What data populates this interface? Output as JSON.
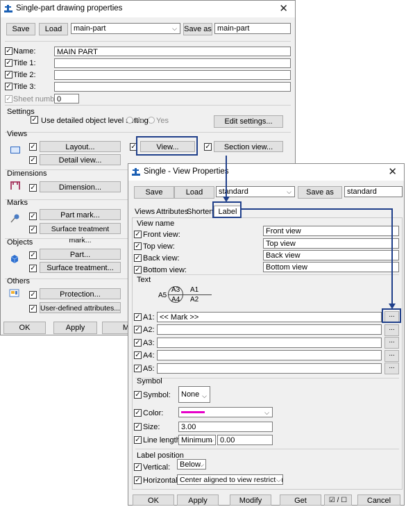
{
  "win1": {
    "title": "Single-part drawing properties",
    "close": "✕",
    "toolbar": {
      "save": "Save",
      "load": "Load",
      "preset": "main-part",
      "save_as": "Save as",
      "save_as_name": "main-part"
    },
    "fields": {
      "name_label": "Name:",
      "name_value": "MAIN PART",
      "title1_label": "Title 1:",
      "title2_label": "Title 2:",
      "title3_label": "Title 3:",
      "sheet_label": "Sheet number",
      "sheet_value": "0"
    },
    "settings": {
      "heading": "Settings",
      "detailed_label": "Use detailed object level settings",
      "no": "No",
      "yes": "Yes",
      "edit": "Edit settings..."
    },
    "views": {
      "heading": "Views",
      "layout": "Layout...",
      "view": "View...",
      "section": "Section view...",
      "detail": "Detail view..."
    },
    "dimensions": {
      "heading": "Dimensions",
      "dimension": "Dimension..."
    },
    "marks": {
      "heading": "Marks",
      "part_mark": "Part mark...",
      "surface_mark": "Surface treatment mark..."
    },
    "objects": {
      "heading": "Objects",
      "part": "Part...",
      "surface": "Surface treatment..."
    },
    "others": {
      "heading": "Others",
      "protection": "Protection...",
      "uda": "User-defined attributes..."
    },
    "bottom": {
      "ok": "OK",
      "apply": "Apply",
      "m": "M"
    }
  },
  "win2": {
    "title": "Single - View Properties",
    "close": "✕",
    "toolbar": {
      "save": "Save",
      "load": "Load",
      "preset": "standard",
      "save_as": "Save as",
      "save_as_name": "standard"
    },
    "tabs": [
      "Views",
      "Attributes",
      "Shortening",
      "Label"
    ],
    "view_name": {
      "heading": "View name",
      "front_label": "Front view:",
      "front_value": "Front view",
      "top_label": "Top view:",
      "top_value": "Top view",
      "back_label": "Back view:",
      "back_value": "Back view",
      "bottom_label": "Bottom view:",
      "bottom_value": "Bottom view"
    },
    "text": {
      "heading": "Text",
      "diagram": {
        "a5": "A5",
        "a3": "A3",
        "a4": "A4",
        "a1": "A1",
        "a2": "A2"
      },
      "rows": [
        {
          "label": "A1:",
          "value": "<< Mark >>"
        },
        {
          "label": "A2:",
          "value": ""
        },
        {
          "label": "A3:",
          "value": ""
        },
        {
          "label": "A4:",
          "value": ""
        },
        {
          "label": "A5:",
          "value": ""
        }
      ],
      "browse": "..."
    },
    "symbol": {
      "heading": "Symbol",
      "symbol_label": "Symbol:",
      "symbol_value": "None",
      "color_label": "Color:",
      "color_swatch": "#e600c8",
      "size_label": "Size:",
      "size_value": "3.00",
      "line_label": "Line length:",
      "line_mode": "Minimum",
      "line_value": "0.00"
    },
    "label_position": {
      "heading": "Label position",
      "vertical_label": "Vertical:",
      "vertical_value": "Below",
      "horizontal_label": "Horizontal:",
      "horizontal_value": "Center aligned to view restriction box"
    },
    "bottom": {
      "ok": "OK",
      "apply": "Apply",
      "modify": "Modify",
      "get": "Get",
      "toggle": "☑ / ☐",
      "cancel": "Cancel"
    }
  },
  "accent": "#1f3f8a"
}
